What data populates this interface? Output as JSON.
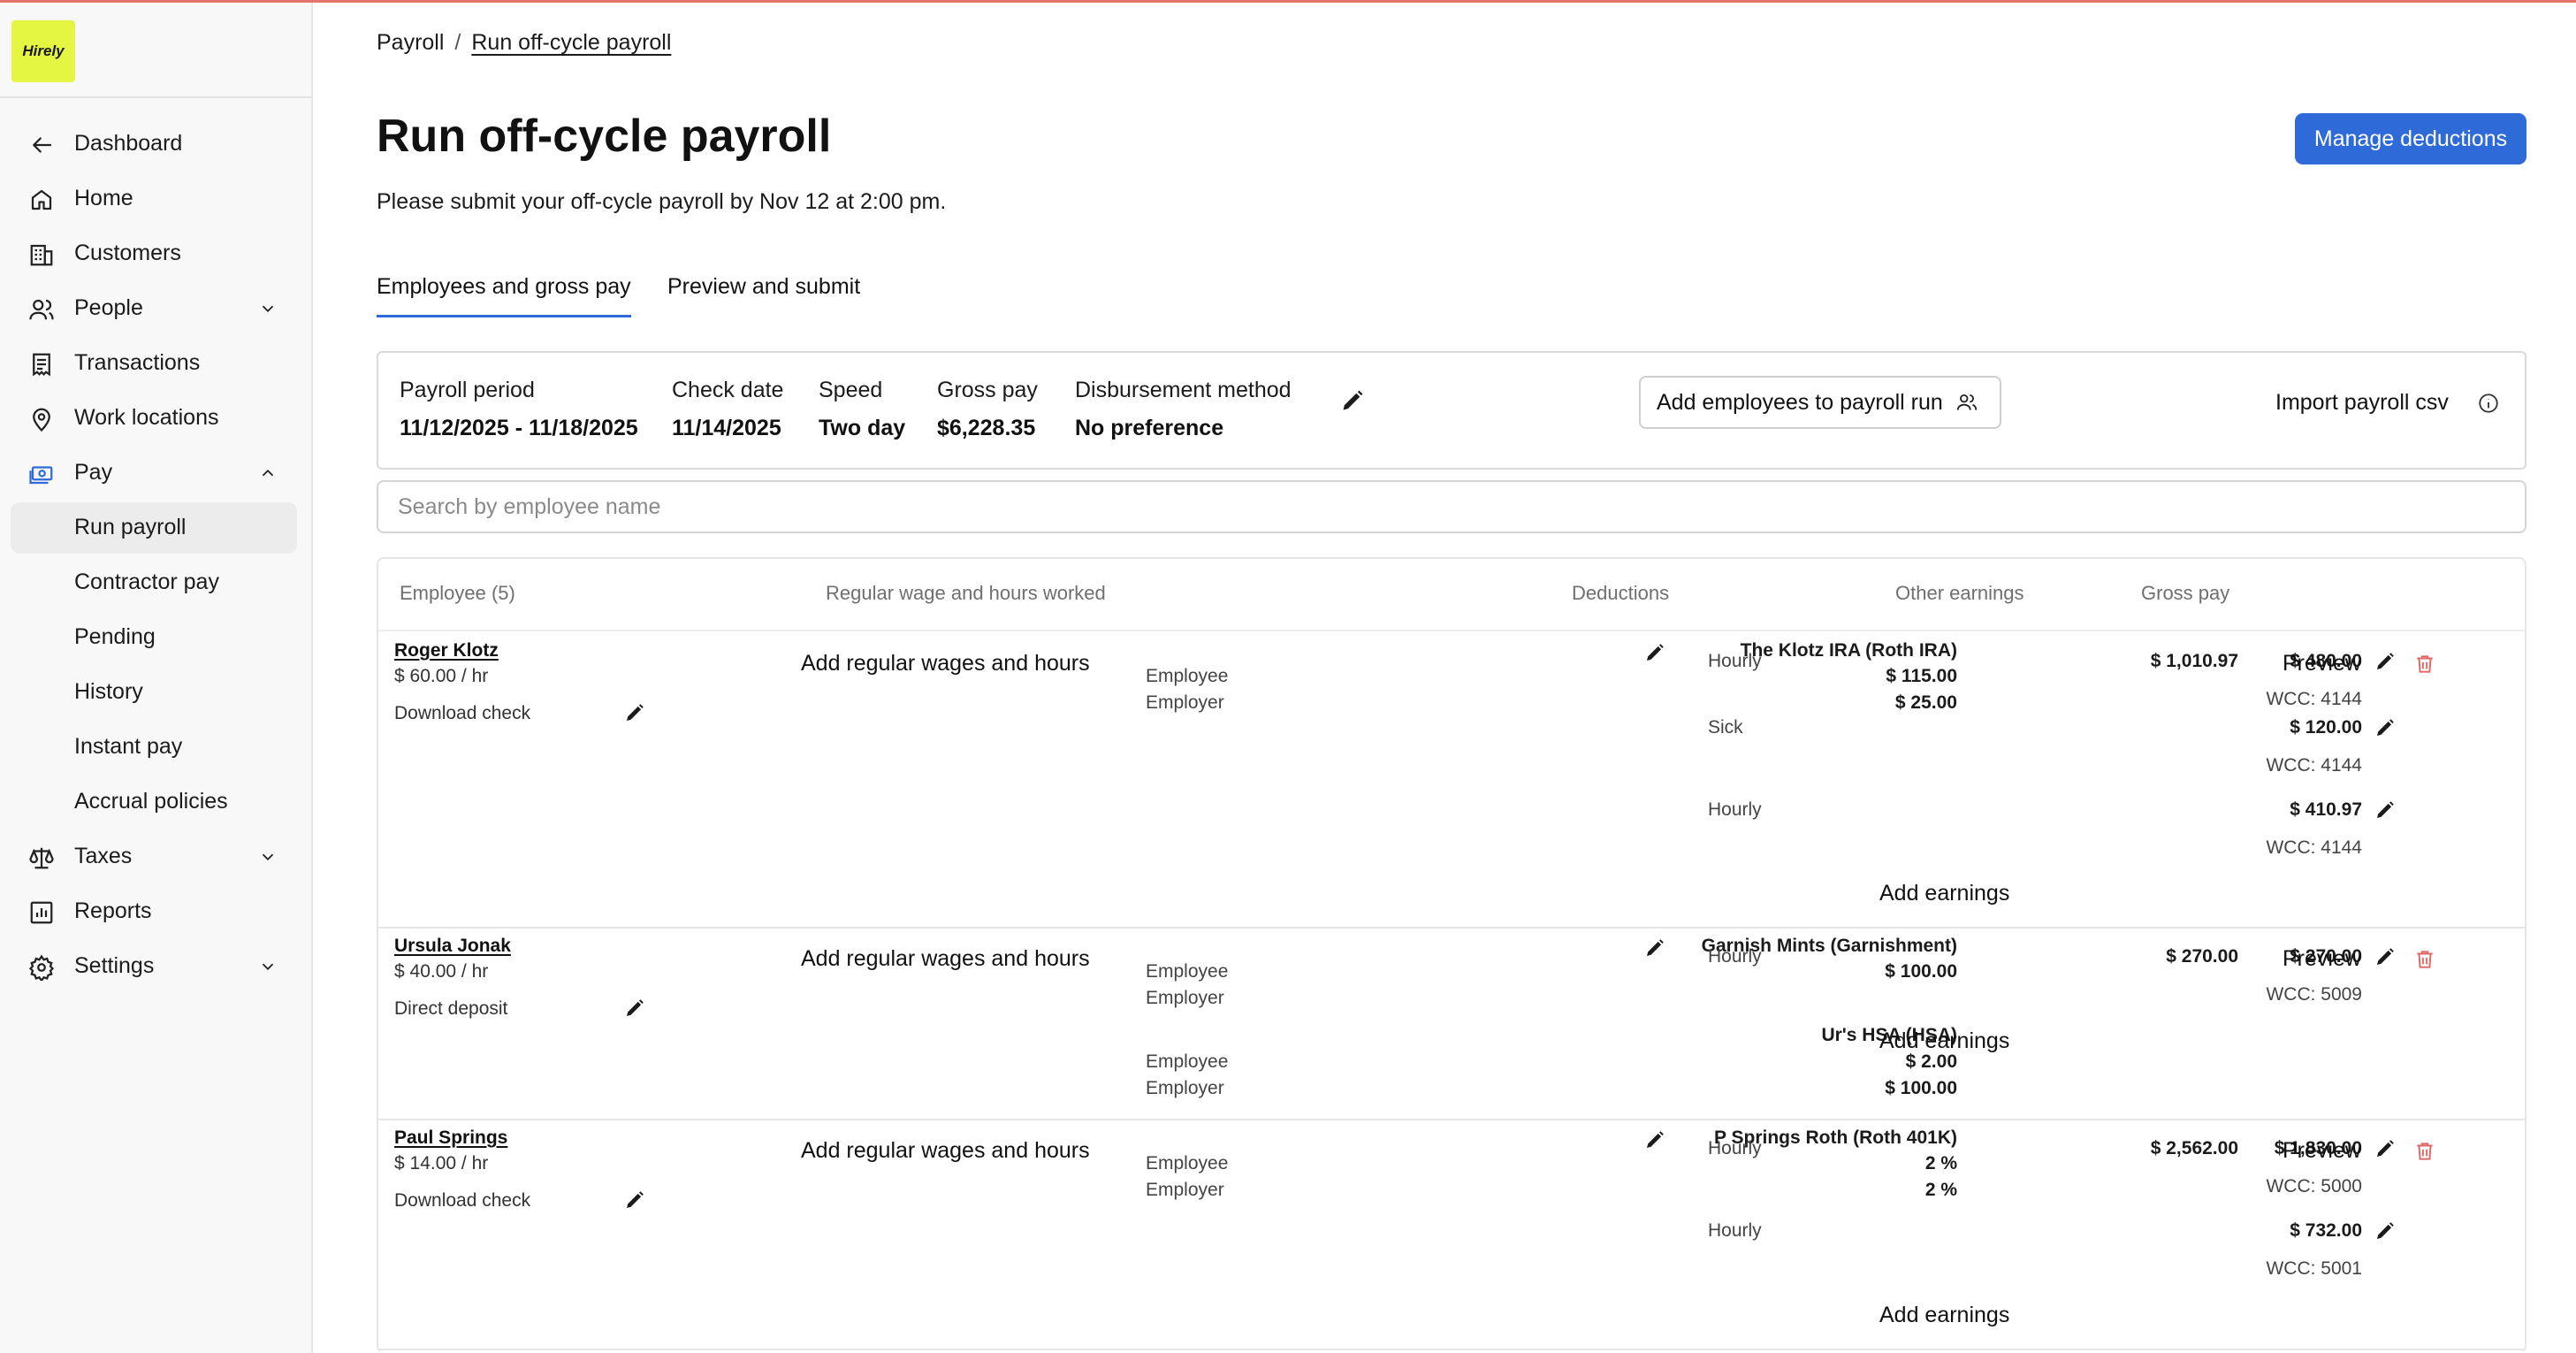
{
  "brand": {
    "logo_text": "Hirely",
    "logo_color": "#e4f542",
    "accent": "#2f6ad9",
    "danger": "#e06565"
  },
  "sidebar": {
    "items": [
      {
        "label": "Dashboard",
        "icon": "arrow-left-icon"
      },
      {
        "label": "Home",
        "icon": "home-icon"
      },
      {
        "label": "Customers",
        "icon": "building-icon"
      },
      {
        "label": "People",
        "icon": "people-icon",
        "expandable": true,
        "expanded": false
      },
      {
        "label": "Transactions",
        "icon": "receipt-icon"
      },
      {
        "label": "Work locations",
        "icon": "map-pin-icon"
      },
      {
        "label": "Pay",
        "icon": "money-icon",
        "expandable": true,
        "expanded": true
      },
      {
        "label": "Run payroll",
        "active": true
      },
      {
        "label": "Contractor pay"
      },
      {
        "label": "Pending"
      },
      {
        "label": "History"
      },
      {
        "label": "Instant pay"
      },
      {
        "label": "Accrual policies"
      },
      {
        "label": "Taxes",
        "icon": "scale-icon",
        "expandable": true,
        "expanded": false
      },
      {
        "label": "Reports",
        "icon": "chart-icon"
      },
      {
        "label": "Settings",
        "icon": "gear-icon",
        "expandable": true,
        "expanded": false
      }
    ]
  },
  "breadcrumb": {
    "root": "Payroll",
    "separator": "/",
    "current": "Run off-cycle payroll"
  },
  "page": {
    "title": "Run off-cycle payroll",
    "subtitle": "Please submit your off-cycle payroll by Nov 12 at 2:00 pm.",
    "manage_deductions": "Manage deductions"
  },
  "tabs": [
    {
      "label": "Employees and gross pay",
      "active": true
    },
    {
      "label": "Preview and submit",
      "active": false
    }
  ],
  "summary": {
    "payroll_period_label": "Payroll period",
    "payroll_period_value": "11/12/2025 - 11/18/2025",
    "check_date_label": "Check date",
    "check_date_value": "11/14/2025",
    "speed_label": "Speed",
    "speed_value": "Two day",
    "gross_pay_label": "Gross pay",
    "gross_pay_value": "$6,228.35",
    "disbursement_label": "Disbursement method",
    "disbursement_value": "No preference",
    "add_employees": "Add employees to payroll run",
    "import_csv": "Import payroll csv"
  },
  "search": {
    "placeholder": "Search by employee name",
    "value": ""
  },
  "table": {
    "headers": {
      "employee": "Employee (5)",
      "regular": "Regular wage and hours worked",
      "deductions": "Deductions",
      "other": "Other earnings",
      "gross": "Gross pay"
    },
    "rows": [
      {
        "name": "Roger Klotz",
        "rate": "$ 60.00 / hr",
        "payment": "Download check",
        "regular": "Add regular wages and hours",
        "deductions": [
          {
            "name": "The Klotz IRA (Roth IRA)",
            "employee_label": "Employee",
            "employee_value": "$ 115.00",
            "employer_label": "Employer",
            "employer_value": "$ 25.00"
          }
        ],
        "earnings": [
          {
            "type": "Hourly",
            "amount": "$ 480.00",
            "wcc": "WCC: 4144"
          },
          {
            "type": "Sick",
            "amount": "$ 120.00",
            "wcc": "WCC: 4144"
          },
          {
            "type": "Hourly",
            "amount": "$ 410.97",
            "wcc": "WCC: 4144"
          }
        ],
        "add_earnings": "Add earnings",
        "gross": "$ 1,010.97",
        "preview": "Preview"
      },
      {
        "name": "Ursula Jonak",
        "rate": "$ 40.00 / hr",
        "payment": "Direct deposit",
        "regular": "Add regular wages and hours",
        "deductions": [
          {
            "name": "Garnish Mints (Garnishment)",
            "employee_label": "Employee",
            "employee_value": "$ 100.00",
            "employer_label": "Employer",
            "employer_value": ""
          },
          {
            "name": "Ur's HSA (HSA)",
            "employee_label": "Employee",
            "employee_value": "$ 2.00",
            "employer_label": "Employer",
            "employer_value": "$ 100.00"
          }
        ],
        "earnings": [
          {
            "type": "Hourly",
            "amount": "$ 270.00",
            "wcc": "WCC: 5009"
          }
        ],
        "add_earnings": "Add earnings",
        "gross": "$ 270.00",
        "preview": "Preview"
      },
      {
        "name": "Paul Springs",
        "rate": "$ 14.00 / hr",
        "payment": "Download check",
        "regular": "Add regular wages and hours",
        "deductions": [
          {
            "name": "P Springs Roth (Roth 401K)",
            "employee_label": "Employee",
            "employee_value": "2 %",
            "employer_label": "Employer",
            "employer_value": "2 %"
          }
        ],
        "earnings": [
          {
            "type": "Hourly",
            "amount": "$ 1,830.00",
            "wcc": "WCC: 5000"
          },
          {
            "type": "Hourly",
            "amount": "$ 732.00",
            "wcc": "WCC: 5001"
          }
        ],
        "add_earnings": "Add earnings",
        "gross": "$ 2,562.00",
        "preview": "Preview"
      }
    ]
  }
}
